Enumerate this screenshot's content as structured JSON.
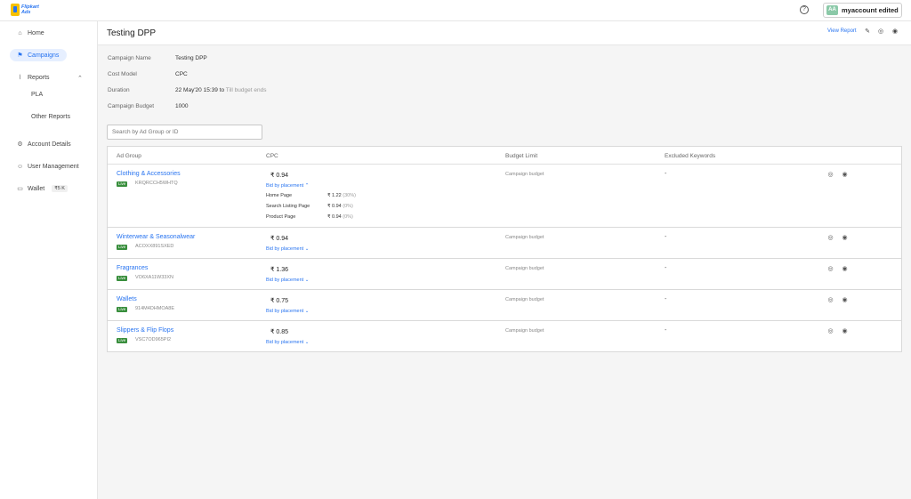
{
  "app": {
    "logo_line1": "Flipkart",
    "logo_line2": "Ads",
    "help_icon": "?",
    "account_initials": "AA",
    "account_name": "myaccount edited"
  },
  "sidebar": {
    "items": [
      {
        "label": "Home",
        "icon": "home-icon"
      },
      {
        "label": "Campaigns",
        "icon": "flag-icon"
      },
      {
        "label": "Reports",
        "icon": "chart-icon"
      },
      {
        "label": "PLA"
      },
      {
        "label": "Other Reports"
      },
      {
        "label": "Account Details",
        "icon": "gear-icon"
      },
      {
        "label": "User Management",
        "icon": "user-icon"
      },
      {
        "label": "Wallet",
        "icon": "wallet-icon"
      }
    ],
    "wallet_balance": "₹5 K"
  },
  "header": {
    "title": "Testing DPP",
    "view_report": "View Report"
  },
  "details": {
    "campaign_name_label": "Campaign Name",
    "campaign_name": "Testing DPP",
    "cost_model_label": "Cost Model",
    "cost_model": "CPC",
    "duration_label": "Duration",
    "duration_start": "22 May'20 15:39",
    "duration_to": "to",
    "duration_end": "Till budget ends",
    "budget_label": "Campaign Budget",
    "budget": "1000"
  },
  "search": {
    "placeholder": "Search by Ad Group or ID"
  },
  "table": {
    "headers": [
      "Ad Group",
      "CPC",
      "Budget Limit",
      "Excluded Keywords"
    ],
    "rows": [
      {
        "name": "Clothing & Accessories",
        "status": "Live",
        "id": "KRQRCCH5WHTQ",
        "cpc": "₹  0.94",
        "bid": "Bid by placement  ⌃",
        "budget": "Campaign budget",
        "keywords": "-"
      },
      {
        "name": "Winterwear & Seasonalwear",
        "status": "Live",
        "id": "ACOXX891SXED",
        "cpc": "₹  0.94",
        "bid": "Bid by placement  ⌄",
        "budget": "Campaign budget",
        "keywords": "-"
      },
      {
        "name": "Fragrances",
        "status": "Live",
        "id": "VO6XA11W33XN",
        "cpc": "₹  1.36",
        "bid": "Bid by placement  ⌄",
        "budget": "Campaign budget",
        "keywords": "-"
      },
      {
        "name": "Wallets",
        "status": "Live",
        "id": "914M4DHMOA8E",
        "cpc": "₹  0.75",
        "bid": "Bid by placement  ⌄",
        "budget": "Campaign budget",
        "keywords": "-"
      },
      {
        "name": "Slippers & Flip Flops",
        "status": "Live",
        "id": "VSC7OD965PI2",
        "cpc": "₹  0.85",
        "bid": "Bid by placement  ⌄",
        "budget": "Campaign budget",
        "keywords": "-"
      }
    ],
    "placements": [
      {
        "page": "Home Page",
        "bid": "₹  1.22",
        "pct": "(30%)"
      },
      {
        "page": "Search Listing Page",
        "bid": "₹  0.94",
        "pct": "(0%)"
      },
      {
        "page": "Product Page",
        "bid": "₹  0.94",
        "pct": "(0%)"
      }
    ]
  }
}
